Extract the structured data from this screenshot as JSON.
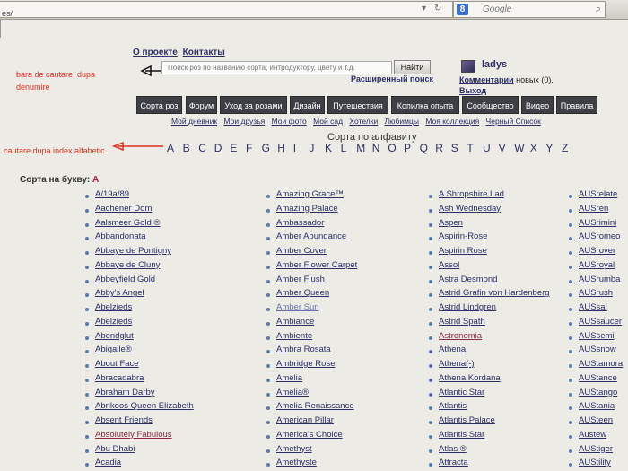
{
  "browser": {
    "url_tail": "es/",
    "search_placeholder": "Google",
    "search_engine_badge": "8"
  },
  "top_links": [
    "О проекте",
    "Контакты"
  ],
  "site_search": {
    "placeholder": "Поиск роз по названию сорта, интродуктору, цвету и т.д.",
    "button": "Найти",
    "advanced": "Расширенный поиск"
  },
  "annotations": {
    "search_note_line1": "bara de cautare, dupa",
    "search_note_line2": "denumire",
    "index_note": "cautare dupa index alfabetic"
  },
  "user": {
    "name": "ladys",
    "comments_link": "Комментарии",
    "comments_text": "новых (0).",
    "logout": "Выход"
  },
  "menu": [
    "Сорта роз",
    "Форум",
    "Уход за розами",
    "Дизайн",
    "Путешествия",
    "Копилка опыта",
    "Сообщество",
    "Видео",
    "Правила"
  ],
  "submenu": [
    "Мой дневник",
    "Мои друзья",
    "Мои фото",
    "Мой сад",
    "Хотелки",
    "Любимцы",
    "Моя коллекция",
    "Черный Список"
  ],
  "alphabet": {
    "title": "Сорта по алфавиту",
    "letters": [
      "A",
      "B",
      "C",
      "D",
      "E",
      "F",
      "G",
      "H",
      "I",
      "J",
      "K",
      "L",
      "M",
      "N",
      "O",
      "P",
      "Q",
      "R",
      "S",
      "T",
      "U",
      "V",
      "W",
      "X",
      "Y",
      "Z"
    ]
  },
  "by_letter": {
    "label": "Сорта на букву:",
    "letter": "A"
  },
  "columns": [
    [
      "A/19a/89",
      "Aachener Dom",
      "Aalsmeer Gold ®",
      "Abbandonata",
      "Abbaye de Pontigny",
      "Abbaye de Cluny",
      "Abbeyfield Gold",
      "Abby's Angel",
      "Abelzieds",
      "Abelzieds",
      "Abendglut",
      "Abigaile®",
      "About Face",
      "Abracadabra",
      "Abraham Darby",
      "Abrikoos Queen Elizabeth",
      "Absent Friends",
      "Absolutely Fabulous",
      "Abu Dhabi",
      "Acadia"
    ],
    [
      "Amazing Grace™",
      "Amazing Palace",
      "Ambassador",
      "Amber Abundance",
      "Amber Cover",
      "Amber Flower Carpet",
      "Amber Flush",
      "Amber Queen",
      "Amber Sun",
      "Ambiance",
      "Ambiente",
      "Ambra Rosata",
      "Ambridge Rose",
      "Amelia",
      "Amelia®",
      "Amelia Renaissance",
      "American Pillar",
      "America's Choice",
      "Amethyst",
      "Amethyste"
    ],
    [
      "A Shropshire Lad",
      "Ash Wednesday",
      "Aspen",
      "Aspirin-Rose",
      "Aspirin Rose",
      "Assol",
      "Astra Desmond",
      "Astrid Grafin von Hardenberg",
      "Astrid Lindgren",
      "Astrid Spath",
      "Astronomia",
      "Athena",
      "Athena(-)",
      "Athena Kordana",
      "Atlantic Star",
      "Atlantis",
      "Atlantis Palace",
      "Atlantis Star",
      "Atlas ®",
      "Attracta"
    ],
    [
      "AUSrelate",
      "AUSren",
      "AUSrimini",
      "AUSromeo",
      "AUSrover",
      "AUSroyal",
      "AUSrumba",
      "AUSrush",
      "AUSsal",
      "AUSsaucer",
      "AUSsemi",
      "AUSsnow",
      "AUStamora",
      "AUStance",
      "AUStango",
      "AUStania",
      "AUSteen",
      "Austew",
      "AUStiger",
      "AUStility"
    ]
  ],
  "visited": [
    "Absolutely Fabulous",
    "Astronomia"
  ],
  "faded": [
    "Amber Sun"
  ]
}
